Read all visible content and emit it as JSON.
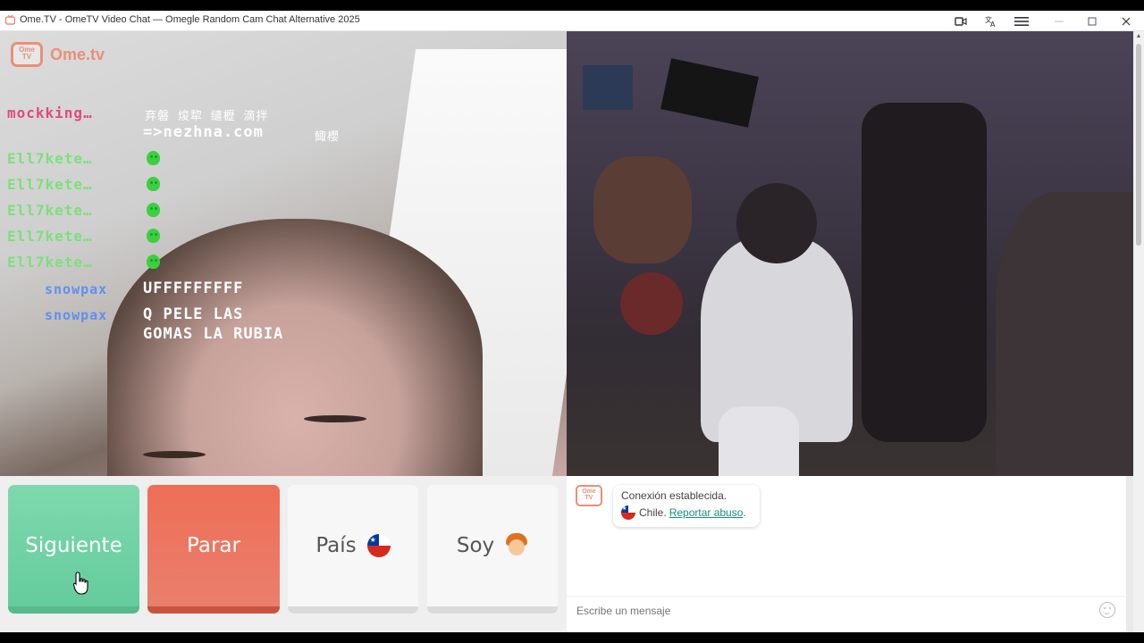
{
  "window": {
    "title": "Ome.TV - OmeTV Video Chat — Omegle Random Cam Chat Alternative 2025"
  },
  "logo": {
    "box": "Ome TV",
    "text": "Ome.tv"
  },
  "overlay_chat": [
    {
      "name": "mockking…",
      "text": "弃磐  焌犂  缱櫪  滴拌",
      "color": "#e04a7a"
    },
    {
      "name": "",
      "text": "=>nezhna.com",
      "extra": "鯫櫻"
    },
    {
      "name": "Ell7kete…",
      "emoji": "green-blob"
    },
    {
      "name": "Ell7kete…",
      "emoji": "green-blob"
    },
    {
      "name": "Ell7kete…",
      "emoji": "green-blob"
    },
    {
      "name": "Ell7kete…",
      "emoji": "green-blob"
    },
    {
      "name": "Ell7kete…",
      "emoji": "green-blob"
    },
    {
      "name": "snowpax",
      "text": "UFFFFFFFFF"
    },
    {
      "name": "snowpax",
      "text": "Q PELE LAS",
      "text2": "GOMAS LA RUBIA"
    }
  ],
  "controls": {
    "next": "Siguiente",
    "stop": "Parar",
    "country": "País",
    "me": "Soy"
  },
  "chat": {
    "status": "Conexión establecida.",
    "country": "Chile.",
    "report": "Reportar abuso",
    "placeholder": "Escribe un mensaje"
  },
  "colors": {
    "next_button": "#6fd3a6",
    "stop_button": "#ec7560",
    "brand": "#ea8f77",
    "link": "#1a8f7a"
  }
}
